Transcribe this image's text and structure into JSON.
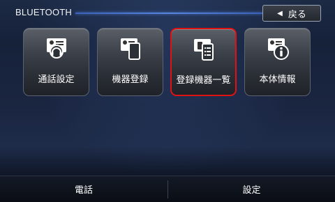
{
  "header": {
    "title": "BLUETOOTH",
    "back_label": "戻る"
  },
  "tiles": [
    {
      "label": "通話設定",
      "icon": "headset-settings-icon",
      "selected": false
    },
    {
      "label": "機器登録",
      "icon": "phone-register-icon",
      "selected": false
    },
    {
      "label": "登録機器一覧",
      "icon": "device-list-icon",
      "selected": true
    },
    {
      "label": "本体情報",
      "icon": "info-icon",
      "selected": false
    }
  ],
  "footer": {
    "left_label": "電話",
    "right_label": "設定"
  },
  "colors": {
    "selection": "#e01212",
    "accent_line": "#4a78d8"
  }
}
